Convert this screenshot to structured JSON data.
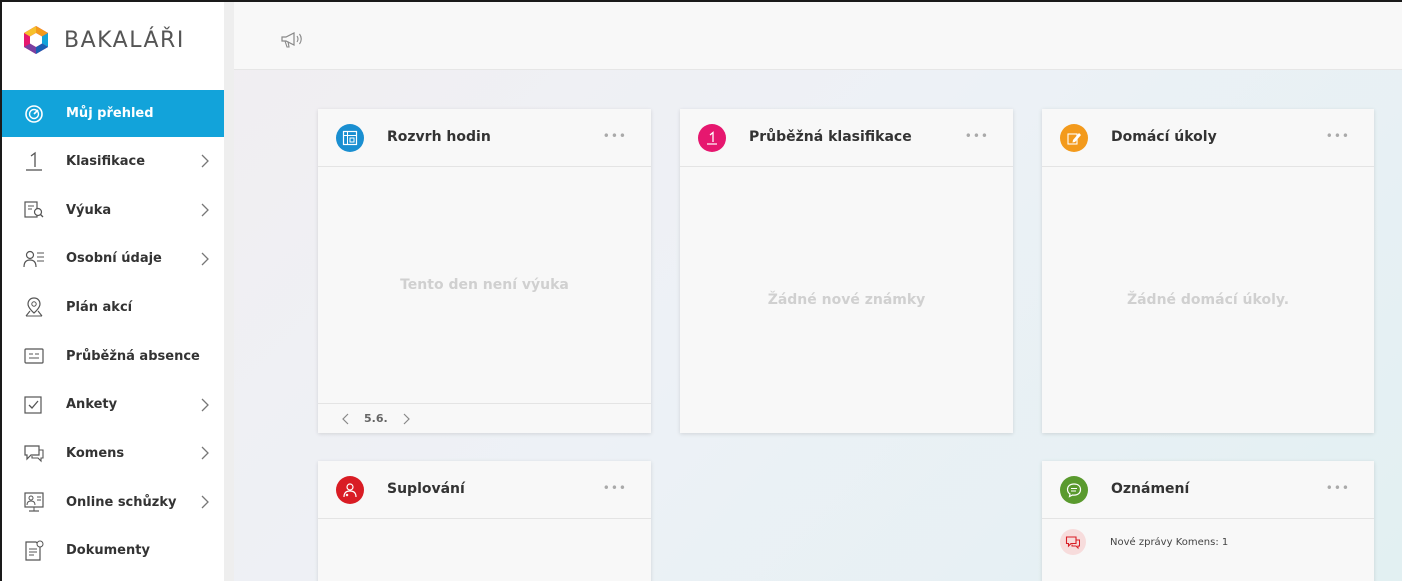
{
  "app": {
    "name": "BAKALÁŘI"
  },
  "sidebar": {
    "items": [
      {
        "label": "Můj přehled",
        "icon": "dashboard-icon",
        "active": true,
        "chevron": false
      },
      {
        "label": "Klasifikace",
        "icon": "grade-one-icon",
        "active": false,
        "chevron": true
      },
      {
        "label": "Výuka",
        "icon": "book-search-icon",
        "active": false,
        "chevron": true
      },
      {
        "label": "Osobní údaje",
        "icon": "person-list-icon",
        "active": false,
        "chevron": true
      },
      {
        "label": "Plán akcí",
        "icon": "location-pin-icon",
        "active": false,
        "chevron": false
      },
      {
        "label": "Průběžná absence",
        "icon": "absence-card-icon",
        "active": false,
        "chevron": false
      },
      {
        "label": "Ankety",
        "icon": "checkbox-icon",
        "active": false,
        "chevron": true
      },
      {
        "label": "Komens",
        "icon": "chat-icon",
        "active": false,
        "chevron": true
      },
      {
        "label": "Online schůzky",
        "icon": "video-meeting-icon",
        "active": false,
        "chevron": true
      },
      {
        "label": "Dokumenty",
        "icon": "document-icon",
        "active": false,
        "chevron": false
      }
    ]
  },
  "topbar": {
    "icon": "megaphone-icon"
  },
  "cards": {
    "rozvrh": {
      "title": "Rozvrh hodin",
      "empty": "Tento den není výuka",
      "date": "5.6.",
      "dots": "•••"
    },
    "klasifikace": {
      "title": "Průběžná klasifikace",
      "empty": "Žádné nové známky",
      "dots": "•••"
    },
    "ukoly": {
      "title": "Domácí úkoly",
      "empty": "Žádné domácí úkoly.",
      "dots": "•••"
    },
    "suplovani": {
      "title": "Suplování",
      "dots": "•••"
    },
    "oznameni": {
      "title": "Oznámení",
      "dots": "•••",
      "notice": "Nové zprávy Komens: 1"
    }
  },
  "colors": {
    "accent": "#12a3da",
    "rozvrh": "#1a8fd1",
    "klasifikace": "#e6176f",
    "ukoly": "#f39a1c",
    "suplovani": "#d91c24",
    "oznameni": "#5a9a2e"
  }
}
